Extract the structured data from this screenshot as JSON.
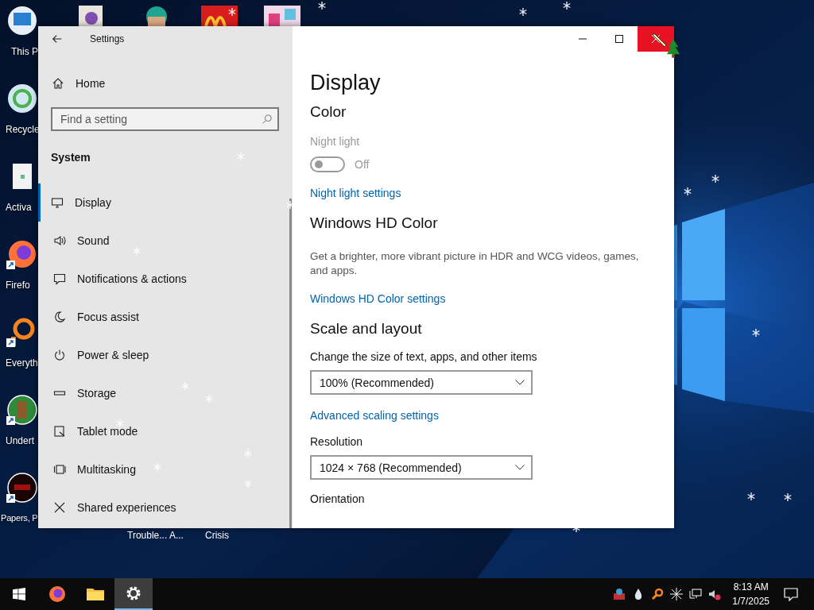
{
  "desktop": {
    "icons": [
      {
        "kind": "computer",
        "label": "This P",
        "shortcut": false
      },
      {
        "kind": "recycle",
        "label": "Recycle",
        "shortcut": false
      },
      {
        "kind": "book",
        "label": "Activa",
        "shortcut": false
      },
      {
        "kind": "firefox",
        "label": "Firefo",
        "shortcut": true
      },
      {
        "kind": "magnifier",
        "label": "Everyth",
        "shortcut": true
      },
      {
        "kind": "character",
        "label": "Undert",
        "shortcut": true
      },
      {
        "kind": "seal",
        "label": "Papers, P",
        "shortcut": true
      }
    ],
    "top_icons": [
      {
        "kind": "document"
      },
      {
        "kind": "character"
      },
      {
        "kind": "arches"
      },
      {
        "kind": "poster"
      }
    ],
    "hidden_labels": [
      "Trouble... A...",
      "Crisis"
    ]
  },
  "window": {
    "title": "Settings"
  },
  "sidebar": {
    "home": "Home",
    "search": {
      "placeholder": "Find a setting"
    },
    "section": "System",
    "items": [
      {
        "kind": "display",
        "label": "Display",
        "selected": true
      },
      {
        "kind": "sound",
        "label": "Sound",
        "selected": false
      },
      {
        "kind": "notifications",
        "label": "Notifications & actions",
        "selected": false
      },
      {
        "kind": "focus",
        "label": "Focus assist",
        "selected": false
      },
      {
        "kind": "power",
        "label": "Power & sleep",
        "selected": false
      },
      {
        "kind": "storage",
        "label": "Storage",
        "selected": false
      },
      {
        "kind": "tablet",
        "label": "Tablet mode",
        "selected": false
      },
      {
        "kind": "multitasking",
        "label": "Multitasking",
        "selected": false
      },
      {
        "kind": "shared",
        "label": "Shared experiences",
        "selected": false
      }
    ]
  },
  "content": {
    "title": "Display",
    "blocks": [
      {
        "kind": "section",
        "text": "Color"
      },
      {
        "kind": "label",
        "text": "Night light",
        "disabled": true
      },
      {
        "kind": "toggle",
        "text": "Off",
        "on": false,
        "disabled": true
      },
      {
        "kind": "link",
        "text": "Night light settings"
      },
      {
        "kind": "section",
        "text": "Windows HD Color"
      },
      {
        "kind": "paragraph",
        "text": "Get a brighter, more vibrant picture in HDR and WCG videos, games, and apps."
      },
      {
        "kind": "link",
        "text": "Windows HD Color settings"
      },
      {
        "kind": "section",
        "text": "Scale and layout"
      },
      {
        "kind": "label",
        "text": "Change the size of text, apps, and other items",
        "disabled": false
      },
      {
        "kind": "dropdown",
        "value": "100% (Recommended)"
      },
      {
        "kind": "link",
        "text": "Advanced scaling settings"
      },
      {
        "kind": "label",
        "text": "Resolution",
        "disabled": false
      },
      {
        "kind": "dropdown",
        "value": "1024 × 768 (Recommended)"
      },
      {
        "kind": "label",
        "text": "Orientation",
        "disabled": false
      }
    ]
  },
  "taskbar": {
    "apps": [
      {
        "kind": "firefox",
        "selected": false
      },
      {
        "kind": "folder",
        "selected": false
      },
      {
        "kind": "settings",
        "selected": true
      }
    ],
    "tray": [
      {
        "kind": "network-box"
      },
      {
        "kind": "drop"
      },
      {
        "kind": "magnifier"
      },
      {
        "kind": "spark"
      },
      {
        "kind": "monitor"
      },
      {
        "kind": "speaker-muted"
      }
    ],
    "time": "8:13 AM",
    "date": "1/7/2025"
  }
}
